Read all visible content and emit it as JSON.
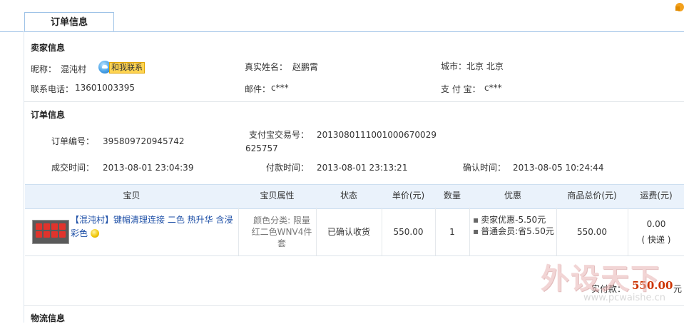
{
  "tab": {
    "label": "订单信息"
  },
  "seller": {
    "title": "卖家信息",
    "nickname_label": "昵称：",
    "nickname": "混沌村",
    "contact_label": "和我联系",
    "realname_label": "真实姓名：",
    "realname": "赵鹏霄",
    "city_label": "城市：",
    "city": "北京 北京",
    "phone_label": "联系电话：",
    "phone": "13601003395",
    "email_label": "邮件：",
    "email": "c***",
    "alipay_label": "支 付 宝：",
    "alipay": "c***"
  },
  "order": {
    "title": "订单信息",
    "number_label": "订单编号：",
    "number": "395809720945742",
    "trade_label": "支付宝交易号：",
    "trade_line1": "2013080111001000670029",
    "trade_line2": "625757",
    "deal_time_label": "成交时间：",
    "deal_time": "2013-08-01 23:04:39",
    "pay_time_label": "付款时间：",
    "pay_time": "2013-08-01 23:13:21",
    "confirm_time_label": "确认时间：",
    "confirm_time": "2013-08-05 10:24:44"
  },
  "table": {
    "headers": [
      "宝贝",
      "宝贝属性",
      "状态",
      "单价(元)",
      "数量",
      "优惠",
      "商品总价(元)",
      "运费(元)"
    ],
    "row": {
      "product": "【混沌村】键帽清理连接 二色 热升华 含浸 彩色",
      "attr_line1": "颜色分类: 限量",
      "attr_line2": "红二色WNV4件",
      "attr_line3": "套",
      "status": "已确认收货",
      "price": "550.00",
      "qty": "1",
      "discount1": "卖家优惠-5.50元",
      "discount2": "普通会员:省5.50元",
      "subtotal": "550.00",
      "shipping": "0.00",
      "shipping_method": "( 快递 )"
    }
  },
  "total": {
    "label": "实付款：",
    "amount": "550.00",
    "unit": "元"
  },
  "logistics": {
    "title": "物流信息"
  },
  "watermark": {
    "text": "外设天下",
    "url": "www.pcwaishe.cn"
  }
}
